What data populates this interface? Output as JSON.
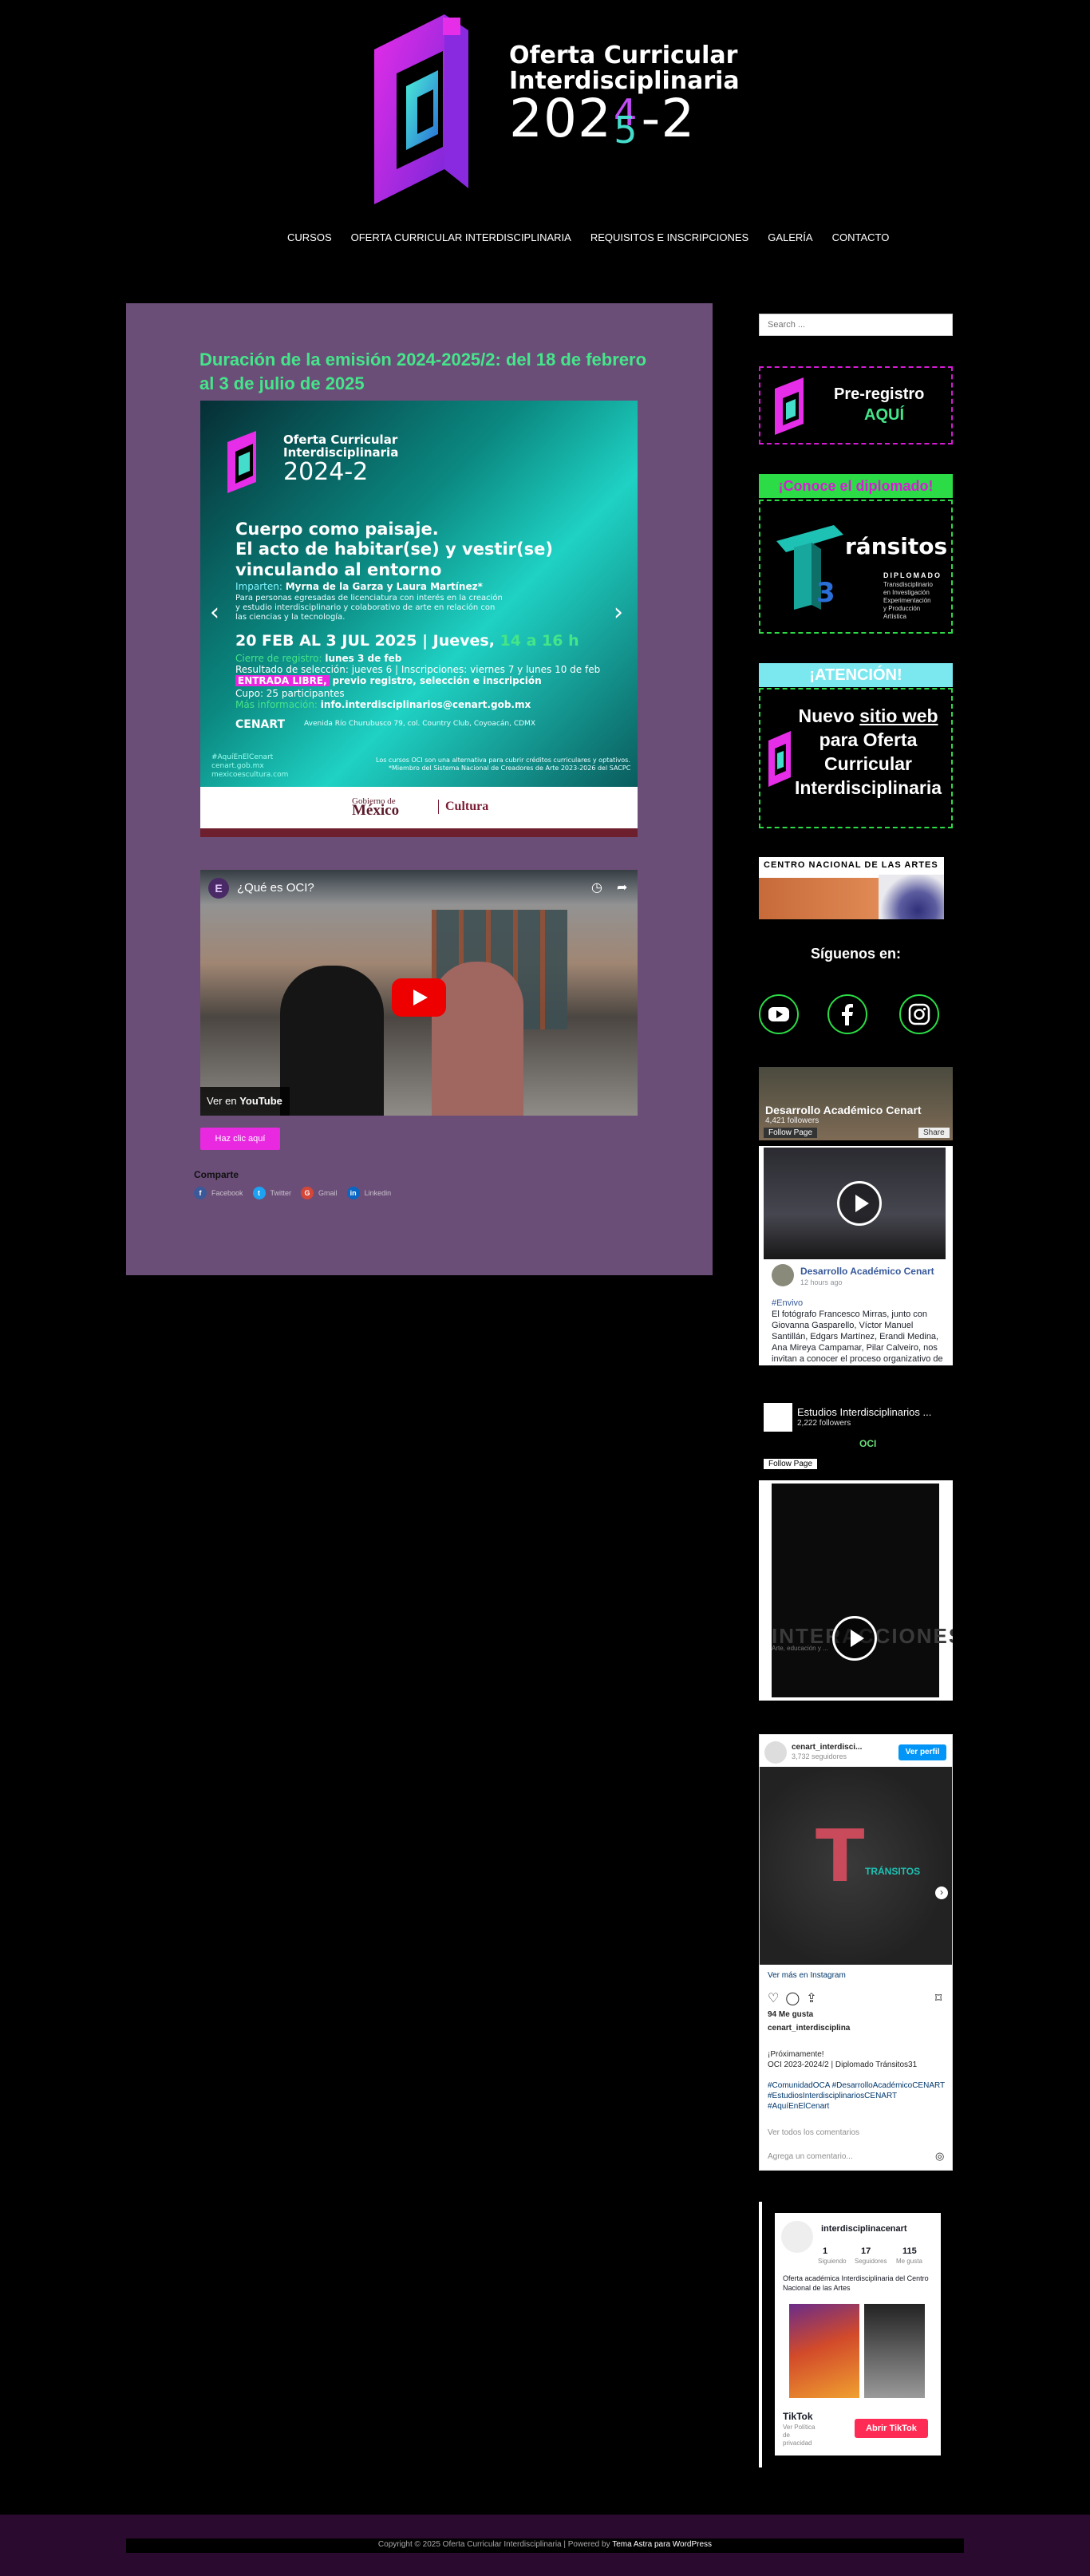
{
  "header": {
    "logo_line1": "Oferta Curricular",
    "logo_line2": "Interdisciplinaria",
    "logo_year_a": "202",
    "logo_year_4": "4",
    "logo_year_5": "5",
    "logo_year_b": "-2",
    "nav": [
      "CURSOS",
      "OFERTA CURRICULAR INTERDISCIPLINARIA",
      "REQUISITOS E INSCRIPCIONES",
      "GALERÍA",
      "CONTACTO"
    ]
  },
  "article": {
    "title": "Duración de la emisión 2024-2025/2: del 18 de febrero al 3 de julio de 2025",
    "slide": {
      "oci_line1": "Oferta Curricular",
      "oci_line2": "Interdisciplinaria",
      "year": "2024-2",
      "heading1": "Cuerpo como paisaje.",
      "heading2": "El acto de habitar(se) y vestir(se)",
      "heading3": "vinculando al entorno",
      "imparten_label": "Imparten:",
      "imparten": "Myrna de la Garza y Laura Martínez*",
      "desc1": "Para personas egresadas de licenciatura con interés en la creación",
      "desc2": "y estudio interdisciplinario y colaborativo de arte en relación con",
      "desc3": "las ciencias y la tecnología.",
      "date": "20 FEB AL 3 JUL 2025 | Jueves,",
      "hours": "14 a 16 h",
      "cierre_label": "Cierre de registro:",
      "cierre": "lunes 3 de feb",
      "resultado": "Resultado de selección: jueves 6 | Inscripciones: viernes 7 y lunes 10 de feb",
      "entrada": "ENTRADA LIBRE,",
      "entrada_rest": "previo registro, selección e inscripción",
      "cupo": "Cupo: 25 participantes",
      "info_label": "Más información:",
      "info": "info.interdisciplinarios@cenart.gob.mx",
      "cenart": "CENART",
      "address": "Avenida Río Churubusco 79, col. Country Club, Coyoacán, CDMX",
      "social1": "#AquíEnElCenart",
      "social2": "cenart.gob.mx",
      "social3": "mexicoescultura.com",
      "note1": "Los cursos OCI son una alternativa para cubrir créditos curriculares y optativos.",
      "note2": "*Miembro del Sistema Nacional de Creadores de Arte 2023-2026 del SACPC",
      "gob_small": "Gobierno de",
      "gob_big": "México",
      "cultura": "Cultura",
      "prev": "‹",
      "next": "›"
    },
    "video": {
      "channel": "E",
      "title": "¿Qué es OCI?",
      "watch_on": "Ver en",
      "youtube": "YouTube"
    },
    "cta": "Haz clic aquí",
    "share_heading": "Comparte",
    "share": [
      {
        "icon": "f",
        "label": "Facebook",
        "color": "#3b5998"
      },
      {
        "icon": "t",
        "label": "Twitter",
        "color": "#1da1f2"
      },
      {
        "icon": "G",
        "label": "Gmail",
        "color": "#d44638"
      },
      {
        "icon": "in",
        "label": "Linkedin",
        "color": "#0a66c2"
      }
    ]
  },
  "sidebar": {
    "search_placeholder": "Search ...",
    "prereg_line1": "Pre-registro",
    "prereg_line2": "AQUÍ",
    "diplomado_head": "¡Conoce el diplomado!",
    "diplomado_title": "ránsitos",
    "diplomado_sub1": "DIPLOMADO",
    "diplomado_sub2": "Transdisciplinario",
    "diplomado_sub3": "en Investigación",
    "diplomado_sub4": "Experimentación",
    "diplomado_sub5": "y Producción",
    "diplomado_sub6": "Artística",
    "atencion_head": "¡ATENCIÓN!",
    "atencion_pre": "Nuevo",
    "atencion_link": "sitio web",
    "atencion_l2": "para Oferta",
    "atencion_l3": "Curricular",
    "atencion_l4": "Interdisciplinaria",
    "cenart_banner": "CENTRO NACIONAL DE LAS ARTES",
    "follow_heading": "Síguenos en:",
    "fb1": {
      "name": "Desarrollo Académico Cenart",
      "followers": "4,421 followers",
      "follow": "Follow Page",
      "share": "Share"
    },
    "fb_post": {
      "name": "Desarrollo Académico Cenart",
      "time": "12 hours ago",
      "tag": "#Envivo",
      "text": "El fotógrafo Francesco Mirras, junto con Giovanna Gasparello, Víctor Manuel Santillán, Edgars Martínez, Erandi Medina, Ana Mireya Campamar, Pilar Calveiro, nos invitan a conocer el proceso organizativo de"
    },
    "fb2": {
      "name": "Estudios Interdisciplinarios ...",
      "followers": "2,222 followers",
      "follow": "Follow Page",
      "logo": "OCI"
    },
    "fb_video": {
      "title": "INTERACCIONES",
      "subtitle": "Arte, educación y ..."
    },
    "instagram": {
      "user": "cenart_interdisci...",
      "followers": "3,732 seguidores",
      "view_profile": "Ver perfil",
      "image_text": "TRÁNSITOS",
      "more": "Ver más en Instagram",
      "likes": "94 Me gusta",
      "account": "cenart_interdisciplina",
      "caption_1": "¡Próximamente!",
      "caption_2": "OCI 2023-2024/2 | Diplomado Tránsitos31",
      "caption_tags": "#ComunidadOCA #DesarrolloAcadémicoCENART #EstudiosInterdisciplinariosCENART #AquíEnElCenart",
      "comments": "Ver todos los comentarios",
      "add_comment": "Agrega un comentario..."
    },
    "tiktok": {
      "user": "interdisciplinacenart",
      "following": "1",
      "followers": "17",
      "likes": "115",
      "following_label": "Siguiendo",
      "followers_label": "Seguidores",
      "likes_label": "Me gusta",
      "bio": "Oferta académica Interdisciplinaria del Centro Nacional de las Artes",
      "brand": "TikTok",
      "policy1": "Ver Política",
      "policy2": "de",
      "policy3": "privacidad",
      "open": "Abrir TikTok"
    }
  },
  "footer": {
    "copyright": "Copyright © 2025 Oferta Curricular Interdisciplinaria | Powered by",
    "theme": "Tema Astra para WordPress"
  },
  "colors": {
    "accent_green": "#45e58a",
    "accent_magenta": "#e829e0",
    "article_bg": "#6b4e78",
    "cyan": "#7be8f0"
  }
}
